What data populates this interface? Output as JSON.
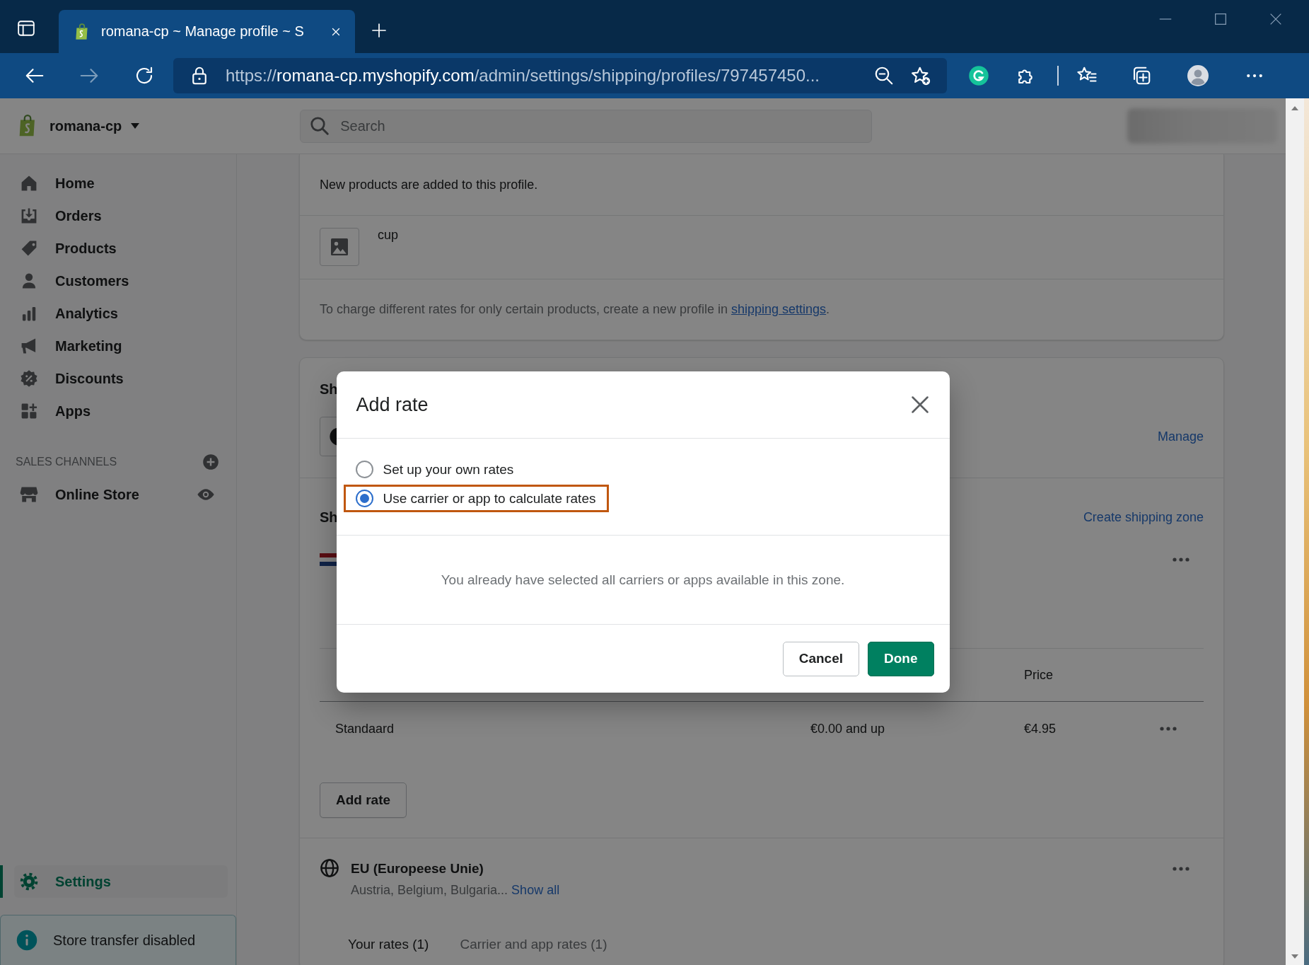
{
  "browser": {
    "tabs": [
      {
        "title": "romana-cp ~ Manage profile ~ S",
        "selected": true
      }
    ],
    "url": {
      "scheme": "https://",
      "host": "romana-cp.myshopify.com",
      "path": "/admin/settings/shipping/profiles/797457450..."
    }
  },
  "topbar": {
    "store_name": "romana-cp",
    "search": {
      "placeholder": "Search"
    }
  },
  "sidebar": {
    "items": [
      {
        "label": "Home",
        "selected": false
      },
      {
        "label": "Orders",
        "selected": false
      },
      {
        "label": "Products",
        "selected": false
      },
      {
        "label": "Customers",
        "selected": false
      },
      {
        "label": "Analytics",
        "selected": false
      },
      {
        "label": "Marketing",
        "selected": false
      },
      {
        "label": "Discounts",
        "selected": false
      },
      {
        "label": "Apps",
        "selected": false
      }
    ],
    "sales_channels": {
      "heading": "SALES CHANNELS",
      "items": [
        {
          "label": "Online Store",
          "selected": false
        }
      ]
    },
    "settings": {
      "label": "Settings",
      "selected": true
    },
    "notice": "Store transfer disabled"
  },
  "profile_card": {
    "note": "New products are added to this profile.",
    "products": [
      {
        "name": "cup"
      }
    ],
    "footer": {
      "text": "To charge different rates for only certain products, create a new profile in",
      "link": "shipping settings",
      "after": "."
    }
  },
  "shipping_card": {
    "heading_1": "Sh",
    "manage_link": "Manage",
    "heading_2": "Sh",
    "create_zone_link": "Create shipping zone",
    "rate_table": {
      "columns": [
        "Price"
      ],
      "rows": [
        {
          "name": "Standaard",
          "condition": "€0.00 and up",
          "price": "€4.95"
        }
      ]
    },
    "add_rate_button": "Add rate",
    "zones": [
      {
        "name": "EU (Europeese Unie)",
        "countries": "Austria, Belgium, Bulgaria...",
        "show_all_link": "Show all",
        "tabs": [
          {
            "label": "Your rates (1)",
            "selected": true
          },
          {
            "label": "Carrier and app rates (1)",
            "selected": false
          }
        ]
      }
    ]
  },
  "modal": {
    "title": "Add rate",
    "options": [
      {
        "label": "Set up your own rates",
        "selected": false,
        "highlighted": false
      },
      {
        "label": "Use carrier or app to calculate rates",
        "selected": true,
        "highlighted": true
      }
    ],
    "message": "You already have selected all carriers or apps available in this zone.",
    "buttons": [
      {
        "label": "Cancel",
        "kind": "secondary"
      },
      {
        "label": "Done",
        "kind": "primary"
      }
    ]
  }
}
